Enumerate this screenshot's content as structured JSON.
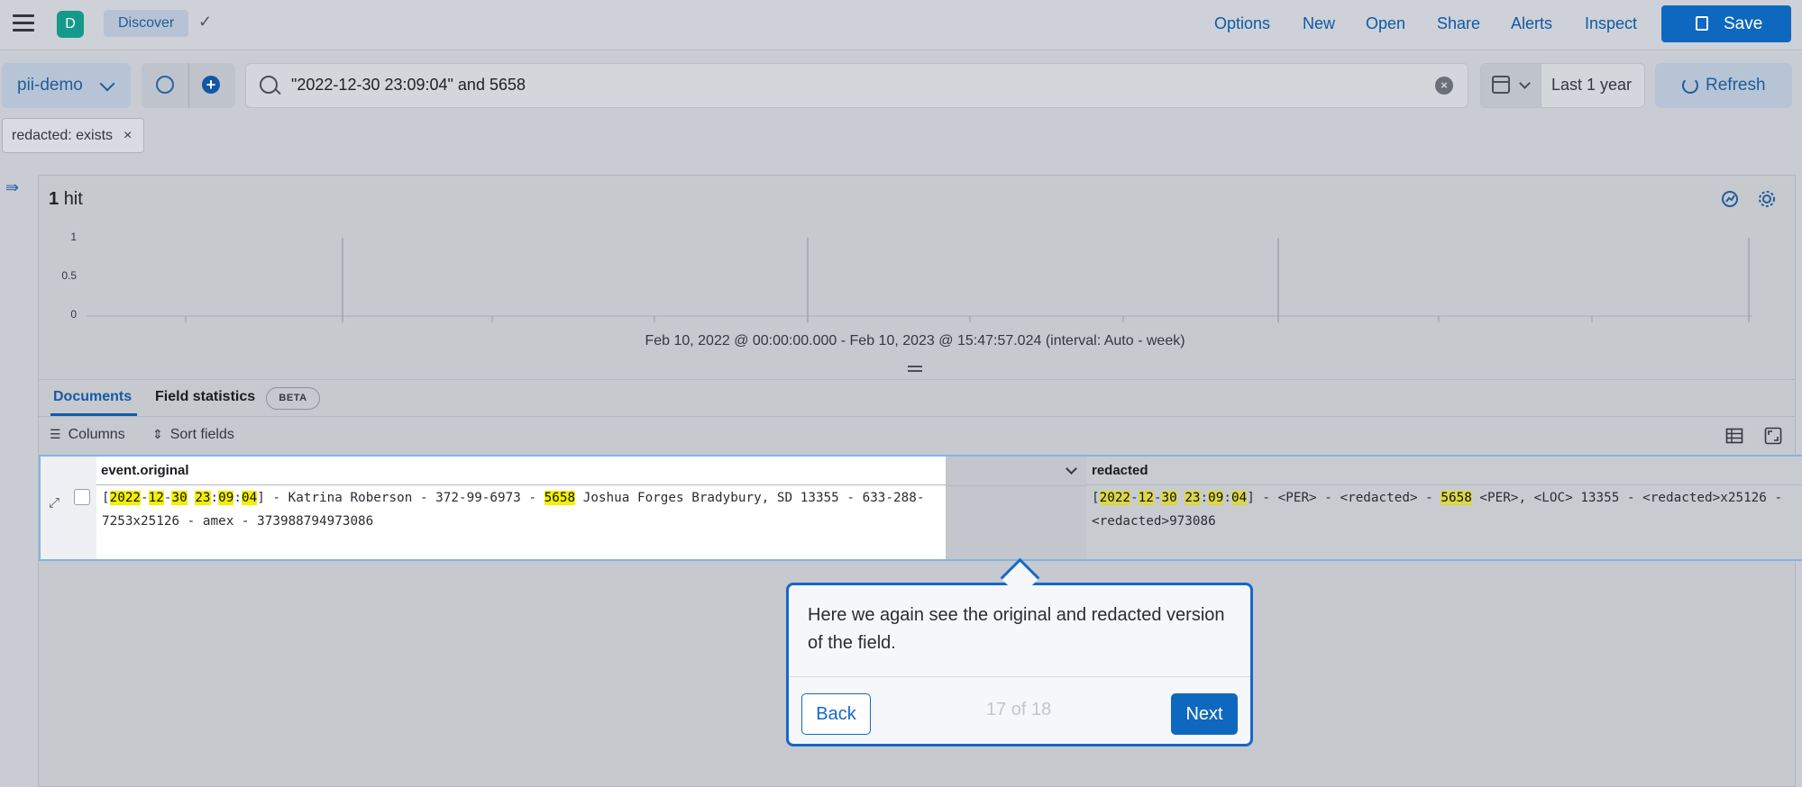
{
  "header": {
    "avatar_letter": "D",
    "breadcrumb": "Discover",
    "nav": [
      "Options",
      "New",
      "Open",
      "Share",
      "Alerts",
      "Inspect"
    ],
    "save_label": "Save"
  },
  "query_bar": {
    "data_view": "pii-demo",
    "query": "\"2022-12-30 23:09:04\" and 5658",
    "date_range": "Last 1 year",
    "refresh_label": "Refresh"
  },
  "filters": [
    {
      "label": "redacted: exists"
    }
  ],
  "results": {
    "hits_count": "1",
    "hits_label": "hit"
  },
  "histogram": {
    "y_ticks": [
      "1",
      "0.5",
      "0"
    ],
    "time_range": "Feb 10, 2022 @ 00:00:00.000 - Feb 10, 2023 @ 15:47:57.024 (interval: Auto - week)"
  },
  "tabs": {
    "documents": "Documents",
    "field_statistics": "Field statistics",
    "beta": "BETA"
  },
  "toolbar": {
    "columns": "Columns",
    "sort_fields": "Sort fields"
  },
  "grid": {
    "columns": [
      "event.original",
      "redacted"
    ]
  },
  "tour": {
    "body": "Here we again see the original and redacted version of the field.",
    "back": "Back",
    "step": "17 of 18",
    "next": "Next"
  },
  "colors": {
    "primary": "#0f68bf",
    "highlight": "#f4f000",
    "avatar": "#14998a"
  }
}
